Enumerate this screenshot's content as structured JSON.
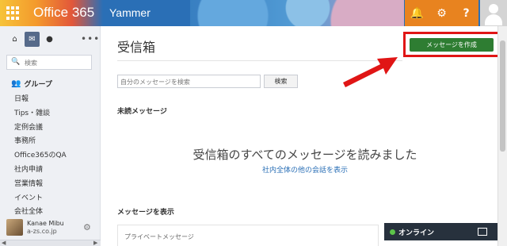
{
  "topbar": {
    "suite_title": "Office 365",
    "app_title": "Yammer",
    "bell_icon": "bell-icon",
    "gear_icon": "gear-icon",
    "help_label": "?",
    "colors": {
      "bar": "#2a6fb6",
      "icon_bg": "#e8831f"
    }
  },
  "sidebar": {
    "nav_icons": [
      "home-icon",
      "mail-icon",
      "bell-icon"
    ],
    "more_label": "•••",
    "search_placeholder": "検索",
    "groups_header": "グループ",
    "groups": [
      "日報",
      "Tips・雑談",
      "定例会議",
      "事務所",
      "Office365のQA",
      "社内申請",
      "営業情報",
      "イベント",
      "会社全体"
    ],
    "profile": {
      "name": "Kanae Mibu",
      "org": "a-zs.co.jp"
    }
  },
  "main": {
    "title": "受信箱",
    "compose_button": "メッセージを作成",
    "search_placeholder": "自分のメッセージを検索",
    "search_button": "検索",
    "unread_header": "未読メッセージ",
    "empty_title": "受信箱のすべてのメッセージを読みました",
    "empty_link": "社内全体の他の会話を表示",
    "show_header": "メッセージを表示",
    "private_label": "プライベートメッセージ",
    "colors": {
      "compose": "#2e7d32",
      "highlight": "#e01515",
      "link": "#2a6fb6"
    }
  },
  "chat": {
    "status_label": "オンライン",
    "status_color": "#5cc44a"
  }
}
